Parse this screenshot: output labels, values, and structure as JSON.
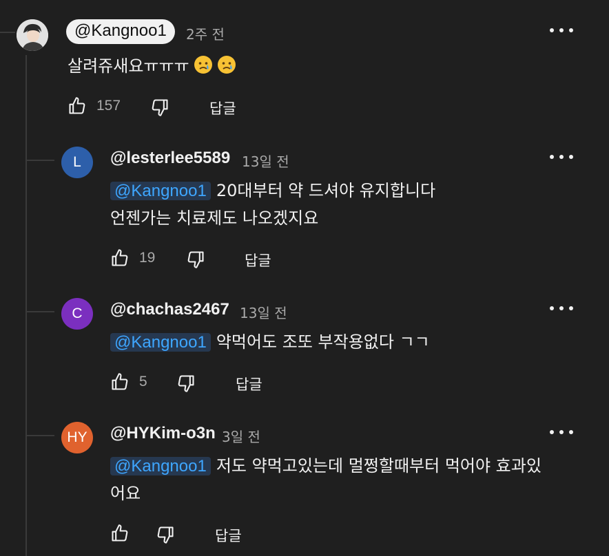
{
  "top_comment": {
    "handle": "@Kangnoo1",
    "time": "2주 전",
    "text": "살려쥬새요ㅠㅠㅠ",
    "emojis": [
      "crying-face",
      "crying-face"
    ],
    "likes": "157",
    "reply_label": "답글"
  },
  "replies": [
    {
      "avatar_letter": "L",
      "avatar_color": "#2d5faa",
      "handle": "@lesterlee5589",
      "time": "13일 전",
      "mention": "@Kangnoo1",
      "line1": "20대부터 약 드셔야 유지합니다",
      "line2": "언젠가는 치료제도 나오겠지요",
      "likes": "19",
      "reply_label": "답글"
    },
    {
      "avatar_letter": "C",
      "avatar_color": "#7b2fbf",
      "handle": "@chachas2467",
      "time": "13일 전",
      "mention": "@Kangnoo1",
      "line1": "약먹어도 조또 부작용없다 ㄱㄱ",
      "likes": "5",
      "reply_label": "답글"
    },
    {
      "avatar_letter": "HY",
      "avatar_color": "#e0622e",
      "handle": "@HYKim-o3n",
      "time": "3일 전",
      "mention": "@Kangnoo1",
      "line1": "저도 약먹고있는데 멀쩡할때부터 먹어야 효과있",
      "line2": "어요",
      "reply_label": "답글"
    }
  ],
  "colors": {
    "background": "#1f1f1f",
    "mention": "#3ea6ff",
    "secondary_text": "#aaaaaa"
  }
}
